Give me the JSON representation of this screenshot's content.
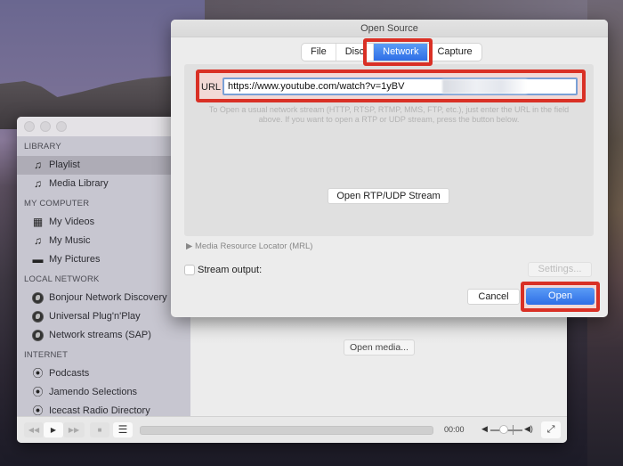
{
  "dialog": {
    "title": "Open Source",
    "tabs": [
      {
        "label": "File",
        "selected": false
      },
      {
        "label": "Disc",
        "selected": false
      },
      {
        "label": "Network",
        "selected": true
      },
      {
        "label": "Capture",
        "selected": false
      }
    ],
    "url_label": "URL",
    "url_value": "https://www.youtube.com/watch?v=1yBV",
    "url_hint": "To Open a usual network stream (HTTP, RTSP, RTMP, MMS, FTP, etc.), just enter the URL in the field above. If you want to open a RTP or UDP stream, press the button below.",
    "rtp_button": "Open RTP/UDP Stream",
    "mrl_toggle": "Media Resource Locator (MRL)",
    "stream_output_label": "Stream output:",
    "stream_output_checked": false,
    "settings_button": "Settings...",
    "cancel_button": "Cancel",
    "open_button": "Open",
    "highlight_color": "#d93025",
    "accent_color": "#2e6ee6"
  },
  "sidebar": {
    "sections": [
      {
        "title": "LIBRARY",
        "items": [
          {
            "label": "Playlist",
            "icon": "playlist-icon",
            "selected": true
          },
          {
            "label": "Media Library",
            "icon": "media-library-icon",
            "selected": false
          }
        ]
      },
      {
        "title": "MY COMPUTER",
        "items": [
          {
            "label": "My Videos",
            "icon": "film-icon"
          },
          {
            "label": "My Music",
            "icon": "music-note-icon"
          },
          {
            "label": "My Pictures",
            "icon": "picture-icon"
          }
        ]
      },
      {
        "title": "LOCAL NETWORK",
        "items": [
          {
            "label": "Bonjour Network Discovery",
            "icon": "globe-icon"
          },
          {
            "label": "Universal Plug'n'Play",
            "icon": "globe-icon"
          },
          {
            "label": "Network streams (SAP)",
            "icon": "globe-icon"
          }
        ]
      },
      {
        "title": "INTERNET",
        "items": [
          {
            "label": "Podcasts",
            "icon": "podcast-icon"
          },
          {
            "label": "Jamendo Selections",
            "icon": "podcast-icon"
          },
          {
            "label": "Icecast Radio Directory",
            "icon": "podcast-icon"
          }
        ]
      }
    ]
  },
  "main": {
    "open_media_button": "Open media..."
  },
  "controls": {
    "rewind": "◀◀",
    "play": "▶",
    "forward": "▶▶",
    "stop": "■",
    "playlist": "☰",
    "time": "00:00",
    "volume_min_icon": "◀",
    "volume_max_icon": "◀)",
    "fullscreen_icon": "⤢"
  }
}
